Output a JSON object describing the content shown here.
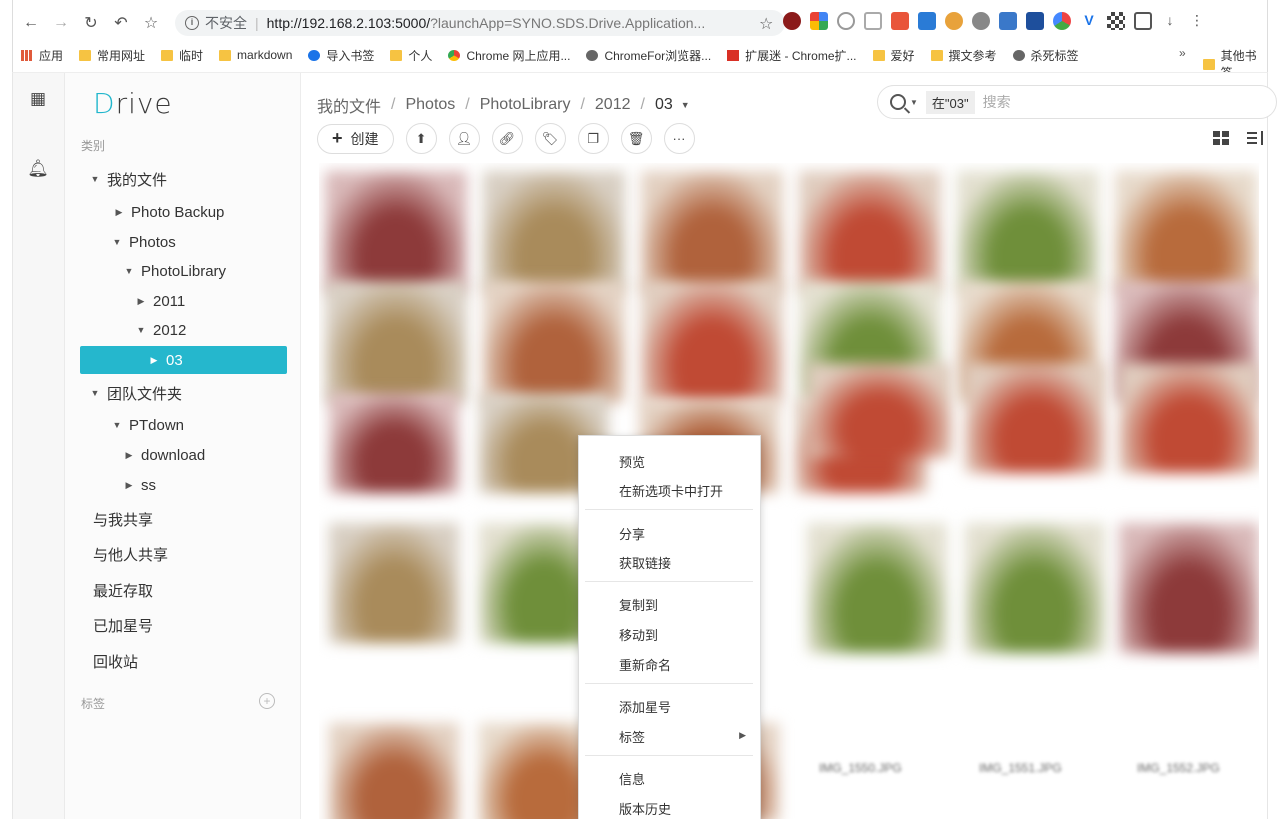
{
  "browser": {
    "nav": {
      "back": "←",
      "forward": "→",
      "reload": "↻",
      "undo": "↶",
      "bookmark": "☆"
    },
    "insecure_label": "不安全",
    "url_host": "http://192.168.2.103:5000/",
    "url_rest": "?launchApp=SYNO.SDS.Drive.Application...",
    "bookmarks": [
      {
        "label": "应用",
        "icon": "apps-grid-icon"
      },
      {
        "label": "常用网址",
        "icon": "folder-icon"
      },
      {
        "label": "临时",
        "icon": "folder-icon"
      },
      {
        "label": "markdown",
        "icon": "folder-icon"
      },
      {
        "label": "导入书签",
        "icon": "gear-icon"
      },
      {
        "label": "个人",
        "icon": "folder-icon"
      },
      {
        "label": "Chrome 网上应用...",
        "icon": "chrome-store-icon"
      },
      {
        "label": "ChromeFor浏览器...",
        "icon": "globe-icon"
      },
      {
        "label": "扩展迷 - Chrome扩...",
        "icon": "ex-icon"
      },
      {
        "label": "爱好",
        "icon": "folder-icon"
      },
      {
        "label": "撰文参考",
        "icon": "folder-icon"
      },
      {
        "label": "杀死标签",
        "icon": "globe-icon"
      }
    ],
    "bookmarks_more": "»",
    "other_bookmarks": "其他书签"
  },
  "app": {
    "logo_text": "rive",
    "logo_d": "D",
    "category_label": "类别",
    "tree": [
      {
        "label": "我的文件",
        "caret": "▼",
        "depth": 0
      },
      {
        "label": "Photo Backup",
        "caret": "▶",
        "depth": 1
      },
      {
        "label": "Photos",
        "caret": "▼",
        "depth": 1
      },
      {
        "label": "PhotoLibrary",
        "caret": "▼",
        "depth": 2
      },
      {
        "label": "2011",
        "caret": "▶",
        "depth": 3
      },
      {
        "label": "2012",
        "caret": "▼",
        "depth": 3
      },
      {
        "label": "03",
        "caret": "▶",
        "depth": 4,
        "selected": true
      },
      {
        "label": "团队文件夹",
        "caret": "▼",
        "depth": 0
      },
      {
        "label": "PTdown",
        "caret": "▼",
        "depth": 1
      },
      {
        "label": "download",
        "caret": "▶",
        "depth": 2
      },
      {
        "label": "ss",
        "caret": "▶",
        "depth": 2
      }
    ],
    "links": [
      "与我共享",
      "与他人共享",
      "最近存取",
      "已加星号",
      "回收站"
    ],
    "tags_label": "标签",
    "breadcrumb": [
      "我的文件",
      "Photos",
      "PhotoLibrary",
      "2012",
      "03"
    ],
    "search": {
      "scope": "在\"03\"",
      "placeholder": "搜索"
    },
    "create_label": "创建",
    "file_names": [
      "IMG_1550.JPG",
      "IMG_1551.JPG",
      "IMG_1552.JPG"
    ],
    "context_menu": [
      "预览",
      "在新选项卡中打开",
      "分享",
      "获取链接",
      "复制到",
      "移动到",
      "重新命名",
      "添加星号",
      "标签",
      "信息",
      "版本历史"
    ]
  },
  "colors": {
    "accent": "#25b7cd",
    "logo": "#21b6cc"
  }
}
